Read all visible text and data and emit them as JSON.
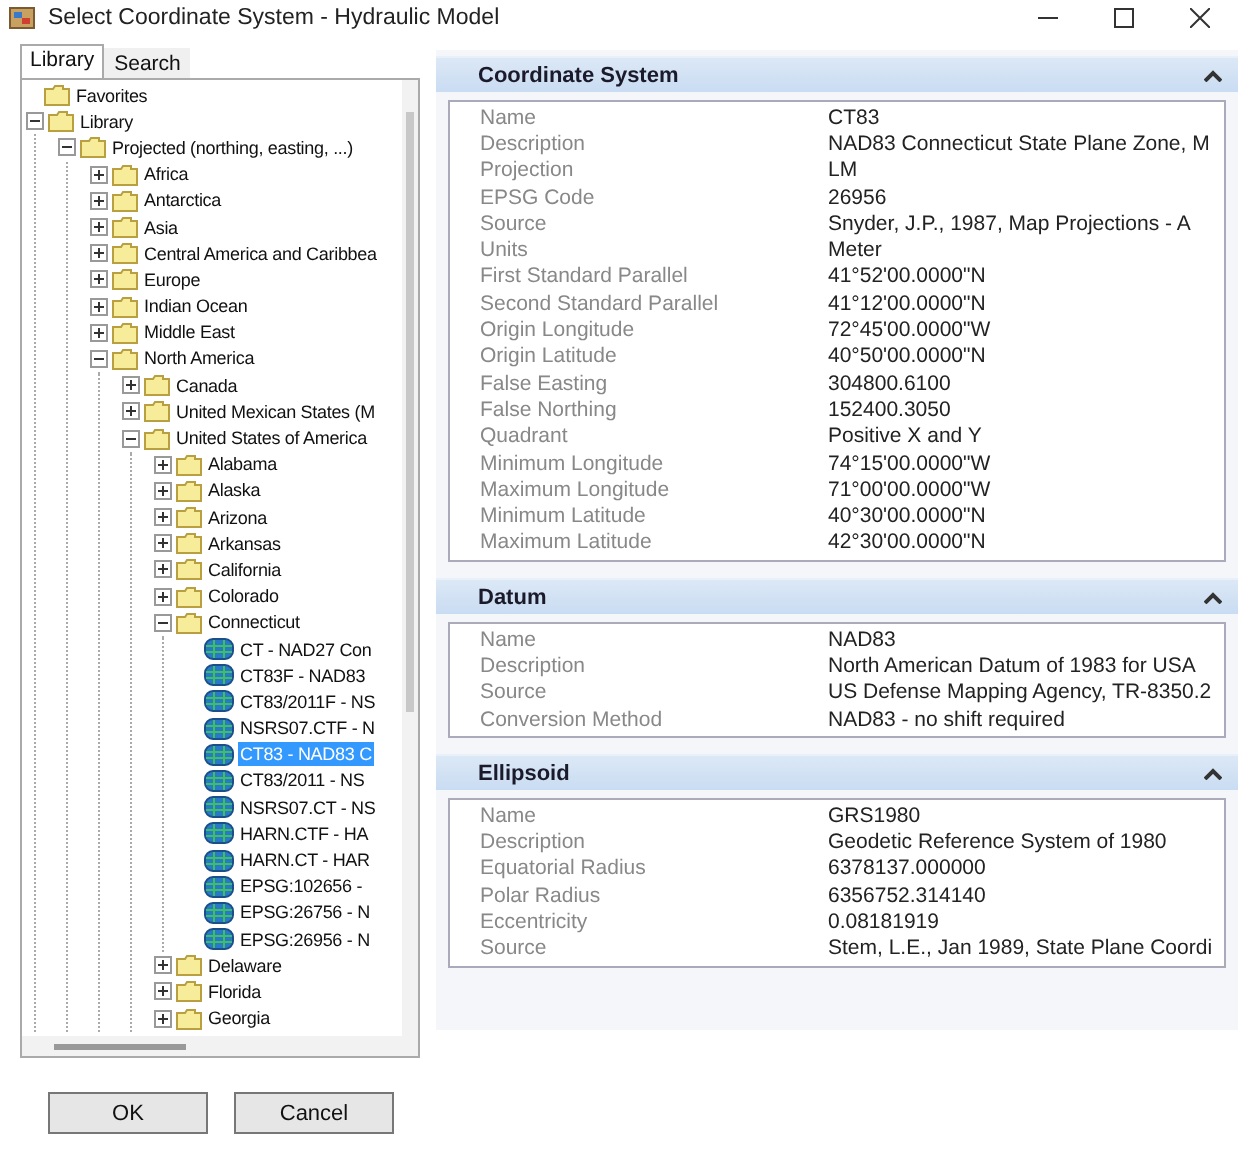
{
  "window": {
    "title": "Select Coordinate System - Hydraulic Model"
  },
  "tabs": [
    {
      "label": "Library",
      "selected": true
    },
    {
      "label": "Search",
      "selected": false
    }
  ],
  "tree": [
    {
      "label": "Favorites",
      "kind": "folder",
      "selected": false
    },
    {
      "label": "Library",
      "kind": "folder",
      "expanded": true,
      "selected": false,
      "children": [
        {
          "label": "Projected (northing, easting, ...)",
          "kind": "folder",
          "expanded": true,
          "selected": false,
          "children": [
            {
              "label": "Africa",
              "kind": "folder",
              "expanded": false,
              "selected": false
            },
            {
              "label": "Antarctica",
              "kind": "folder",
              "expanded": false,
              "selected": false
            },
            {
              "label": "Asia",
              "kind": "folder",
              "expanded": false,
              "selected": false
            },
            {
              "label": "Central America and Caribbea",
              "kind": "folder",
              "expanded": false,
              "selected": false
            },
            {
              "label": "Europe",
              "kind": "folder",
              "expanded": false,
              "selected": false
            },
            {
              "label": "Indian Ocean",
              "kind": "folder",
              "expanded": false,
              "selected": false
            },
            {
              "label": "Middle East",
              "kind": "folder",
              "expanded": false,
              "selected": false
            },
            {
              "label": "North America",
              "kind": "folder",
              "expanded": true,
              "selected": false,
              "children": [
                {
                  "label": "Canada",
                  "kind": "folder",
                  "expanded": false,
                  "selected": false
                },
                {
                  "label": "United Mexican States (M",
                  "kind": "folder",
                  "expanded": false,
                  "selected": false
                },
                {
                  "label": "United States of America",
                  "kind": "folder",
                  "expanded": true,
                  "selected": false,
                  "children": [
                    {
                      "label": "Alabama",
                      "kind": "folder",
                      "expanded": false,
                      "selected": false
                    },
                    {
                      "label": "Alaska",
                      "kind": "folder",
                      "expanded": false,
                      "selected": false
                    },
                    {
                      "label": "Arizona",
                      "kind": "folder",
                      "expanded": false,
                      "selected": false
                    },
                    {
                      "label": "Arkansas",
                      "kind": "folder",
                      "expanded": false,
                      "selected": false
                    },
                    {
                      "label": "California",
                      "kind": "folder",
                      "expanded": false,
                      "selected": false
                    },
                    {
                      "label": "Colorado",
                      "kind": "folder",
                      "expanded": false,
                      "selected": false
                    },
                    {
                      "label": "Connecticut",
                      "kind": "folder",
                      "expanded": true,
                      "selected": false,
                      "children": [
                        {
                          "label": "CT - NAD27 Con",
                          "kind": "system",
                          "selected": false
                        },
                        {
                          "label": "CT83F - NAD83",
                          "kind": "system",
                          "selected": false
                        },
                        {
                          "label": "CT83/2011F - NS",
                          "kind": "system",
                          "selected": false
                        },
                        {
                          "label": "NSRS07.CTF - N",
                          "kind": "system",
                          "selected": false
                        },
                        {
                          "label": "CT83 - NAD83 C",
                          "kind": "system",
                          "selected": true
                        },
                        {
                          "label": "CT83/2011 - NS",
                          "kind": "system",
                          "selected": false
                        },
                        {
                          "label": "NSRS07.CT - NS",
                          "kind": "system",
                          "selected": false
                        },
                        {
                          "label": "HARN.CTF - HA",
                          "kind": "system",
                          "selected": false
                        },
                        {
                          "label": "HARN.CT - HAR",
                          "kind": "system",
                          "selected": false
                        },
                        {
                          "label": "EPSG:102656 -",
                          "kind": "system",
                          "selected": false
                        },
                        {
                          "label": "EPSG:26756 - N",
                          "kind": "system",
                          "selected": false
                        },
                        {
                          "label": "EPSG:26956 - N",
                          "kind": "system",
                          "selected": false
                        }
                      ]
                    },
                    {
                      "label": "Delaware",
                      "kind": "folder",
                      "expanded": false,
                      "selected": false
                    },
                    {
                      "label": "Florida",
                      "kind": "folder",
                      "expanded": false,
                      "selected": false
                    },
                    {
                      "label": "Georgia",
                      "kind": "folder",
                      "expanded": false,
                      "selected": false
                    }
                  ]
                }
              ]
            }
          ]
        }
      ]
    }
  ],
  "panels": [
    {
      "title": "Coordinate System",
      "expanded": true,
      "rows": [
        {
          "label": "Name",
          "value": "CT83"
        },
        {
          "label": "Description",
          "value": "NAD83 Connecticut State Plane Zone, M"
        },
        {
          "label": "Projection",
          "value": "LM"
        },
        {
          "label": "EPSG Code",
          "value": "26956"
        },
        {
          "label": "Source",
          "value": "Snyder, J.P., 1987, Map Projections - A"
        },
        {
          "label": "Units",
          "value": "Meter"
        },
        {
          "label": "First Standard Parallel",
          "value": "41°52'00.0000\"N"
        },
        {
          "label": "Second Standard Parallel",
          "value": "41°12'00.0000\"N"
        },
        {
          "label": "Origin Longitude",
          "value": "72°45'00.0000\"W"
        },
        {
          "label": "Origin Latitude",
          "value": "40°50'00.0000\"N"
        },
        {
          "label": "False Easting",
          "value": "304800.6100"
        },
        {
          "label": "False Northing",
          "value": "152400.3050"
        },
        {
          "label": "Quadrant",
          "value": "Positive X and Y"
        },
        {
          "label": "Minimum Longitude",
          "value": "74°15'00.0000\"W"
        },
        {
          "label": "Maximum Longitude",
          "value": "71°00'00.0000\"W"
        },
        {
          "label": "Minimum Latitude",
          "value": "40°30'00.0000\"N"
        },
        {
          "label": "Maximum Latitude",
          "value": "42°30'00.0000\"N"
        }
      ]
    },
    {
      "title": "Datum",
      "expanded": true,
      "rows": [
        {
          "label": "Name",
          "value": "NAD83"
        },
        {
          "label": "Description",
          "value": "North American Datum of 1983 for USA"
        },
        {
          "label": "Source",
          "value": "US Defense Mapping Agency, TR-8350.2"
        },
        {
          "label": "Conversion Method",
          "value": "NAD83 - no shift required"
        }
      ]
    },
    {
      "title": "Ellipsoid",
      "expanded": true,
      "rows": [
        {
          "label": "Name",
          "value": "GRS1980"
        },
        {
          "label": "Description",
          "value": "Geodetic Reference System of 1980"
        },
        {
          "label": "Equatorial Radius",
          "value": "6378137.000000"
        },
        {
          "label": "Polar Radius",
          "value": "6356752.314140"
        },
        {
          "label": "Eccentricity",
          "value": "0.08181919"
        },
        {
          "label": "Source",
          "value": "Stem, L.E., Jan 1989, State Plane Coordi"
        }
      ]
    }
  ],
  "buttons": [
    "OK",
    "Cancel"
  ]
}
